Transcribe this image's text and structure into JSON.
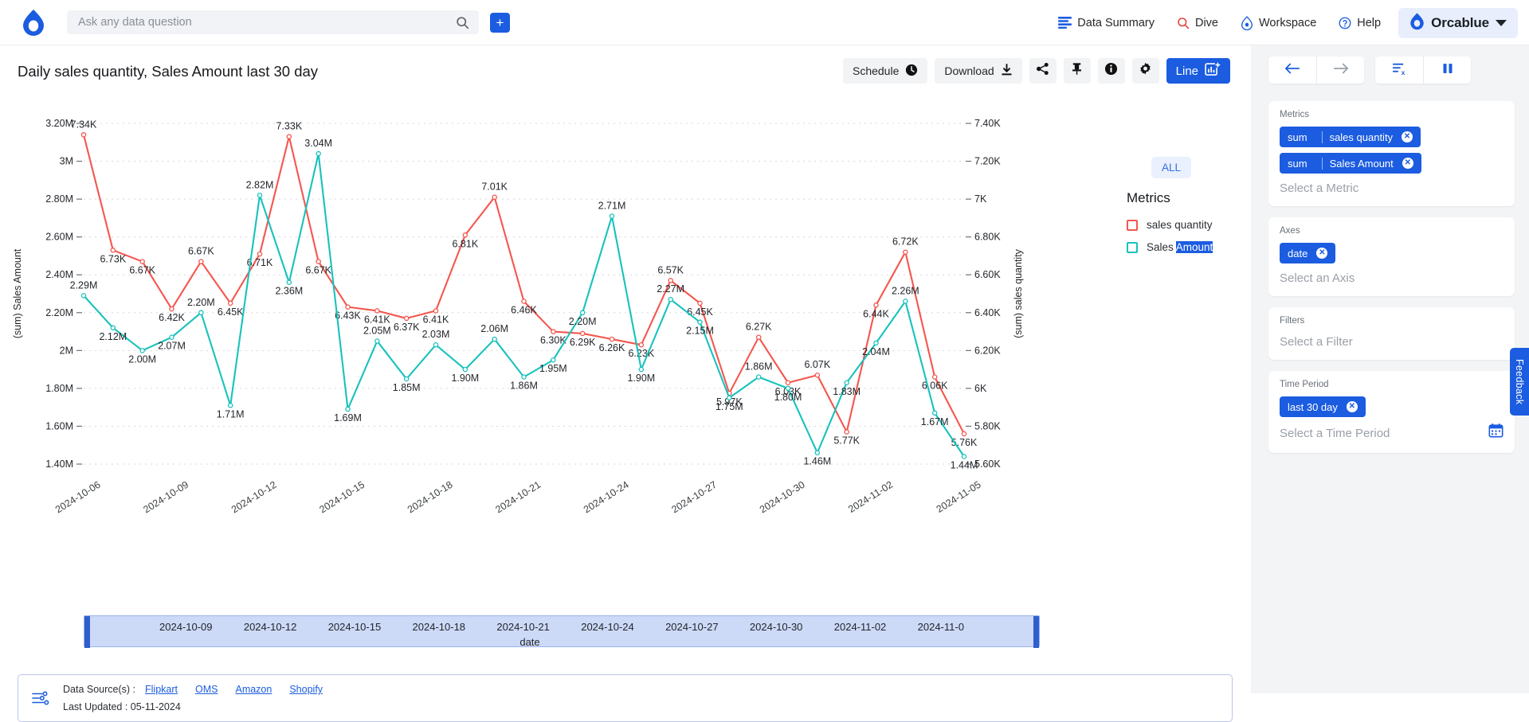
{
  "topbar": {
    "logo_icon": "orca-logo",
    "search": {
      "placeholder": "Ask any data question",
      "value": "",
      "icon": "search-icon"
    },
    "add_button_label": "+",
    "nav": [
      {
        "label": "Data Summary",
        "icon": "data-summary-icon"
      },
      {
        "label": "Dive",
        "icon": "search-icon"
      },
      {
        "label": "Workspace",
        "icon": "workspace-icon"
      },
      {
        "label": "Help",
        "icon": "help-circle-icon"
      }
    ],
    "profile": {
      "name": "Orcablue",
      "icon": "orca-logo",
      "caret": "chevron-down-icon"
    }
  },
  "chart_header": {
    "title": "Daily sales quantity, Sales Amount last 30 day",
    "toolbar": {
      "schedule_label": "Schedule",
      "schedule_icon": "clock-icon",
      "download_label": "Download",
      "download_icon": "download-icon",
      "share_icon": "share-icon",
      "pin_icon": "pin-icon",
      "info_icon": "info-icon",
      "settings_icon": "gear-icon",
      "chart_type_label": "Line",
      "chart_type_icon": "line-chart-icon"
    }
  },
  "legend": {
    "all_button_label": "ALL",
    "title": "Metrics",
    "items": [
      {
        "label": "sales quantity",
        "color": "#f4564e",
        "selected_text": ""
      },
      {
        "label": "Sales ",
        "selected_text": "Amount",
        "color": "#18c2bd"
      }
    ]
  },
  "range_slider": {
    "ticks": [
      "2024-10-09",
      "2024-10-12",
      "2024-10-15",
      "2024-10-18",
      "2024-10-21",
      "2024-10-24",
      "2024-10-27",
      "2024-10-30",
      "2024-11-02",
      "2024-11-0"
    ],
    "axis_label": "date"
  },
  "footer": {
    "icon": "data-source-icon",
    "sources_label": "Data Source(s) :",
    "sources": [
      "Flipkart",
      "OMS",
      "Amazon",
      "Shopify"
    ],
    "last_updated_label": "Last Updated : 05-11-2024"
  },
  "rail": {
    "nav": {
      "back_icon": "arrow-left-icon",
      "forward_icon": "arrow-right-icon",
      "clear_icon": "clear-filters-icon",
      "pause_icon": "pause-icon"
    },
    "metrics": {
      "label": "Metrics",
      "chips": [
        {
          "agg": "sum",
          "name": "sales quantity"
        },
        {
          "agg": "sum",
          "name": "Sales Amount"
        }
      ],
      "placeholder": "Select a Metric"
    },
    "axes": {
      "label": "Axes",
      "chips": [
        {
          "name": "date"
        }
      ],
      "placeholder": "Select an Axis"
    },
    "filters": {
      "label": "Filters",
      "placeholder": "Select a Filter"
    },
    "time_period": {
      "label": "Time Period",
      "chips": [
        {
          "name": "last 30 day"
        }
      ],
      "placeholder": "Select a Time Period",
      "calendar_icon": "calendar-icon"
    },
    "feedback_label": "Feedback"
  },
  "chart_data": {
    "type": "line",
    "title": "Daily sales quantity, Sales Amount last 30 day",
    "xlabel": "date",
    "grid": true,
    "legend_position": "right",
    "x": [
      "2024-10-06",
      "2024-10-07",
      "2024-10-08",
      "2024-10-09",
      "2024-10-10",
      "2024-10-11",
      "2024-10-12",
      "2024-10-13",
      "2024-10-14",
      "2024-10-15",
      "2024-10-16",
      "2024-10-17",
      "2024-10-18",
      "2024-10-19",
      "2024-10-20",
      "2024-10-21",
      "2024-10-22",
      "2024-10-23",
      "2024-10-24",
      "2024-10-25",
      "2024-10-26",
      "2024-10-27",
      "2024-10-28",
      "2024-10-29",
      "2024-10-30",
      "2024-10-31",
      "2024-11-01",
      "2024-11-02",
      "2024-11-03",
      "2024-11-04",
      "2024-11-05"
    ],
    "x_tick_labels": [
      "2024-10-06",
      "2024-10-09",
      "2024-10-12",
      "2024-10-15",
      "2024-10-18",
      "2024-10-21",
      "2024-10-24",
      "2024-10-27",
      "2024-10-30",
      "2024-11-02",
      "2024-11-05"
    ],
    "axes": [
      {
        "name": "(sum) Sales Amount",
        "side": "left",
        "ylim": [
          1400000,
          3200000
        ],
        "ticks": [
          1400000,
          1600000,
          1800000,
          2000000,
          2200000,
          2400000,
          2600000,
          2800000,
          3000000,
          3200000
        ],
        "tick_labels": [
          "1.40M",
          "1.60M",
          "1.80M",
          "2M",
          "2.20M",
          "2.40M",
          "2.60M",
          "2.80M",
          "3M",
          "3.20M"
        ]
      },
      {
        "name": "(sum) sales quantity",
        "side": "right",
        "ylim": [
          5600,
          7400
        ],
        "ticks": [
          5600,
          5800,
          6000,
          6200,
          6400,
          6600,
          6800,
          7000,
          7200,
          7400
        ],
        "tick_labels": [
          "5.60K",
          "5.80K",
          "6K",
          "6.20K",
          "6.40K",
          "6.60K",
          "6.80K",
          "7K",
          "7.20K",
          "7.40K"
        ]
      }
    ],
    "series": [
      {
        "name": "sales quantity",
        "color": "#f4564e",
        "axis": "right",
        "values": [
          7340,
          6730,
          6670,
          6420,
          6670,
          6450,
          6710,
          7330,
          6670,
          6430,
          6410,
          6370,
          6410,
          6810,
          7010,
          6460,
          6300,
          6290,
          6260,
          6230,
          6570,
          6450,
          5974,
          6270,
          6030,
          6070,
          5770,
          6440,
          6720,
          6060,
          5760
        ],
        "labels": [
          "7.34K",
          "6.73K",
          "6.67K",
          "6.42K",
          "6.67K",
          "6.45K",
          "6.71K",
          "7.33K",
          "6.67K",
          "6.43K",
          "6.41K",
          "6.37K",
          "6.41K",
          "6.81K",
          "7.01K",
          "6.46K",
          "6.30K",
          "6.29K",
          "6.26K",
          "6.23K",
          "6.57K",
          "6.45K",
          "5.97K",
          "6.27K",
          "6.03K",
          "6.07K",
          "5.77K",
          "6.44K",
          "6.72K",
          "6.06K",
          "5.76K"
        ]
      },
      {
        "name": "Sales Amount",
        "color": "#18c2bd",
        "axis": "left",
        "values": [
          2290000,
          2120000,
          2000000,
          2070000,
          2200000,
          1710000,
          2820000,
          2360000,
          3040000,
          1690000,
          2050000,
          1850000,
          2030000,
          1900000,
          2060000,
          1860000,
          1950000,
          2200000,
          2710000,
          1900000,
          2270000,
          2150000,
          1750000,
          1860000,
          1800000,
          1460000,
          1830000,
          2040000,
          2260000,
          1670000,
          1440000
        ],
        "labels": [
          "2.29M",
          "2.12M",
          "2.00M",
          "2.07M",
          "2.20M",
          "1.71M",
          "2.82M",
          "2.36M",
          "3.04M",
          "1.69M",
          "2.05M",
          "1.85M",
          "2.03M",
          "1.90M",
          "2.06M",
          "1.86M",
          "1.95M",
          "2.20M",
          "2.71M",
          "1.90M",
          "2.27M",
          "2.15M",
          "1.75M",
          "1.86M",
          "1.80M",
          "1.46M",
          "1.83M",
          "2.04M",
          "2.26M",
          "1.67M",
          "1.44M"
        ]
      }
    ]
  }
}
